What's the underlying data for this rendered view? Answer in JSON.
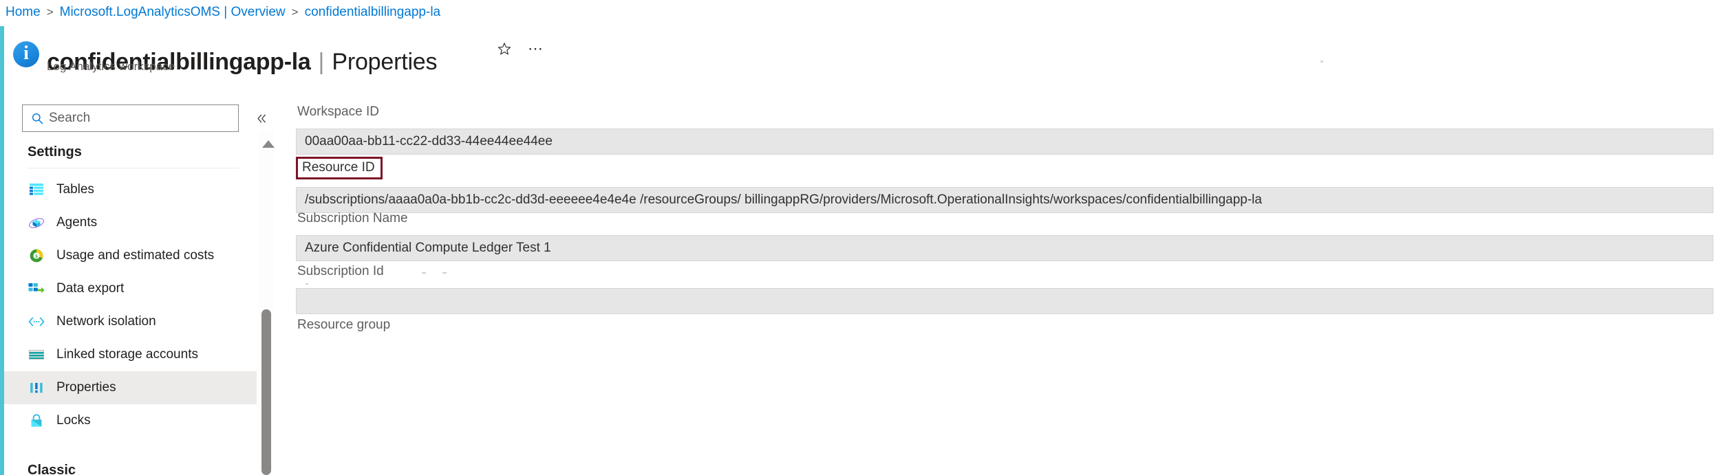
{
  "breadcrumb": {
    "items": [
      {
        "label": "Home"
      },
      {
        "label": "Microsoft.LogAnalyticsOMS | Overview"
      },
      {
        "label": "confidentialbillingapp-la"
      }
    ],
    "separator": ">"
  },
  "header": {
    "resource_name": "confidentialbillingapp-la",
    "separator": "|",
    "blade_name": "Properties",
    "subtitle": "Log Analytics workspace",
    "favorite_icon": "star-outline-icon",
    "more_icon": "ellipsis-icon",
    "resource_type_icon": "info-circle-icon"
  },
  "sidebar": {
    "search": {
      "placeholder": "Search",
      "value": "",
      "icon": "search-icon"
    },
    "collapse_icon": "double-chevron-left-icon",
    "sections": [
      {
        "title": "Settings",
        "items": [
          {
            "label": "Tables",
            "icon": "table-icon",
            "selected": false
          },
          {
            "label": "Agents",
            "icon": "agents-icon",
            "selected": false
          },
          {
            "label": "Usage and estimated costs",
            "icon": "usage-cost-icon",
            "selected": false
          },
          {
            "label": "Data export",
            "icon": "data-export-icon",
            "selected": false
          },
          {
            "label": "Network isolation",
            "icon": "network-isolation-icon",
            "selected": false
          },
          {
            "label": "Linked storage accounts",
            "icon": "linked-storage-icon",
            "selected": false
          },
          {
            "label": "Properties",
            "icon": "properties-icon",
            "selected": true
          },
          {
            "label": "Locks",
            "icon": "lock-icon",
            "selected": false
          }
        ]
      },
      {
        "title": "Classic",
        "items": []
      }
    ]
  },
  "main": {
    "fields": [
      {
        "label": "Workspace ID",
        "value": "00aa00aa-bb11-cc22-dd33-44ee44ee44ee",
        "highlighted": false,
        "redacted": false
      },
      {
        "label": "Resource ID",
        "value": "/subscriptions/aaaa0a0a-bb1b-cc2c-dd3d-eeeeee4e4e4e /resourceGroups/ billingappRG/providers/Microsoft.OperationalInsights/workspaces/confidentialbillingapp-la",
        "highlighted": true,
        "redacted": false
      },
      {
        "label": "Subscription Name",
        "value": "Azure Confidential Compute Ledger Test 1",
        "highlighted": false,
        "redacted": false
      },
      {
        "label": "Subscription Id",
        "value": "",
        "highlighted": false,
        "redacted": true
      },
      {
        "label": "Resource group",
        "value": null,
        "highlighted": false,
        "redacted": false
      }
    ]
  },
  "colors": {
    "accent_teal": "#4dc5d4",
    "link_blue": "#0078d4",
    "highlight_red": "#7d1424",
    "field_background": "#e6e6e6",
    "selected_nav_background": "#edebe9"
  },
  "scrollbar": {
    "up_arrow_icon": "scroll-up-arrow-icon",
    "thumb": "scroll-thumb"
  }
}
